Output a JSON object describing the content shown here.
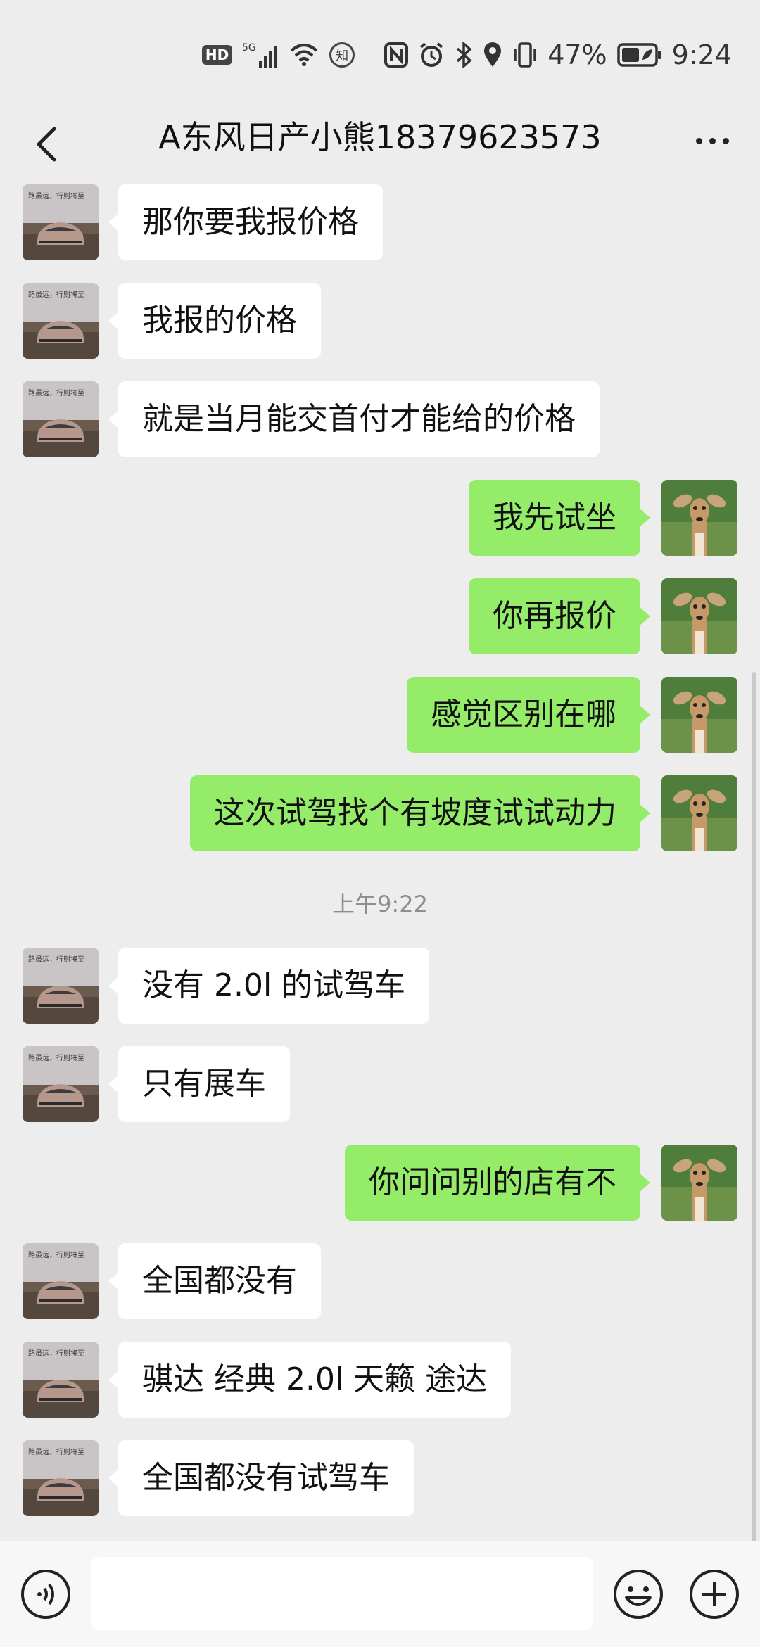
{
  "status_bar": {
    "hd": "HD",
    "network": "5G",
    "zhi": "知",
    "battery_percent": "47%",
    "time": "9:24"
  },
  "header": {
    "title": "A东风日产小熊18379623573"
  },
  "messages": [
    {
      "side": "left",
      "text": "那你要我报价格"
    },
    {
      "side": "left",
      "text": "我报的价格"
    },
    {
      "side": "left",
      "text": "就是当月能交首付才能给的价格"
    },
    {
      "side": "right",
      "text": "我先试坐"
    },
    {
      "side": "right",
      "text": "你再报价"
    },
    {
      "side": "right",
      "text": "感觉区别在哪"
    },
    {
      "side": "right",
      "text": "这次试驾找个有坡度试试动力"
    },
    {
      "type": "time",
      "text": "上午9:22"
    },
    {
      "side": "left",
      "text": "没有 2.0l 的试驾车"
    },
    {
      "side": "left",
      "text": "只有展车"
    },
    {
      "side": "right",
      "text": "你问问别的店有不"
    },
    {
      "side": "left",
      "text": "全国都没有"
    },
    {
      "side": "left",
      "text": "骐达 经典 2.0l 天籁 途达"
    },
    {
      "side": "left",
      "text": "全国都没有试驾车"
    }
  ],
  "contact_avatar": {
    "caption": "路虽远，行则将至"
  },
  "input_bar": {
    "placeholder": ""
  },
  "colors": {
    "background": "#ededed",
    "sent_bubble": "#95ec69",
    "received_bubble": "#ffffff",
    "timestamp": "#8e8e8e"
  }
}
